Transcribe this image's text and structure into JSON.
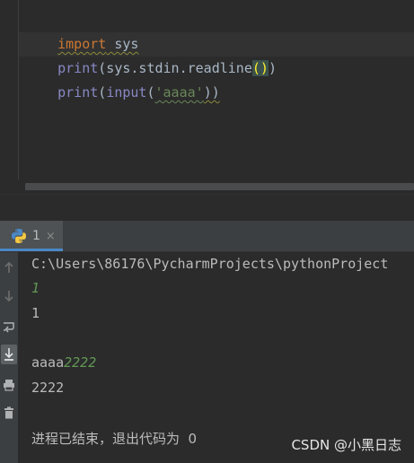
{
  "editor": {
    "line1": {
      "kw": "import",
      "rest": " sys"
    },
    "line2": {
      "fn": "print",
      "open": "(sys.stdin.readline",
      "paren": "()",
      "close": ")"
    },
    "line3": {
      "fn": "print",
      "open": "(",
      "fn2": "input",
      "p2": "(",
      "str": "'aaaa'",
      "close": "))"
    }
  },
  "run_panel": {
    "tab_label": "1",
    "close_glyph": "×"
  },
  "console": {
    "lines": [
      "C:\\Users\\86176\\PycharmProjects\\pythonProject",
      "1",
      "1",
      "",
      "aaaa",
      "2222",
      "2222",
      "进程已结束，退出代码为  0"
    ]
  },
  "watermark": "CSDN @小黑日志",
  "icons": [
    "python-icon",
    "up-arrow-icon",
    "down-arrow-icon",
    "soft-wrap-icon",
    "scroll-to-end-icon",
    "print-icon",
    "trash-icon"
  ],
  "colors": {
    "editor_bg": "#2b2b2b",
    "keyword": "#cc7832",
    "builtin": "#8888c6",
    "string": "#6a8759",
    "input_echo": "#629755",
    "text": "#bbbbbb",
    "tab_accent": "#4a88c7"
  }
}
